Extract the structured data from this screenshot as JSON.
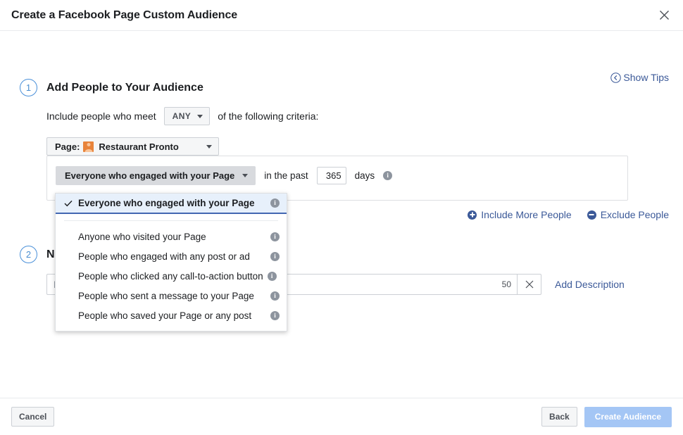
{
  "header": {
    "title": "Create a Facebook Page Custom Audience",
    "close_icon": "close-icon"
  },
  "tips": {
    "label": "Show Tips",
    "icon": "chevron-left-circle-icon"
  },
  "step1": {
    "number": "1",
    "title": "Add People to Your Audience",
    "criteria_prefix": "Include people who meet",
    "match_operator": "ANY",
    "criteria_suffix": "of the following criteria:",
    "page_label": "Page:",
    "page_name": "Restaurant Pronto",
    "condition_value": "Everyone who engaged with your Page",
    "in_the_past": "in the past",
    "days_value": "365",
    "days_label": "days"
  },
  "links": {
    "include_more": "Include More People",
    "exclude": "Exclude People"
  },
  "dropdown": {
    "items": [
      {
        "label": "Everyone who engaged with your Page",
        "selected": true
      },
      {
        "label": "Anyone who visited your Page",
        "selected": false
      },
      {
        "label": "People who engaged with any post or ad",
        "selected": false
      },
      {
        "label": "People who clicked any call-to-action button",
        "selected": false
      },
      {
        "label": "People who sent a message to your Page",
        "selected": false
      },
      {
        "label": "People who saved your Page or any post",
        "selected": false
      }
    ]
  },
  "step2": {
    "number": "2",
    "title": "Name Your Audience",
    "name_placeholder": "Name Your Audience",
    "name_value": "",
    "char_count": "50",
    "add_description": "Add Description"
  },
  "footer": {
    "cancel": "Cancel",
    "back": "Back",
    "create": "Create Audience"
  },
  "colors": {
    "accent_blue": "#3b5998",
    "selected_blue": "#4267b2",
    "selected_bg": "#e7f0fb",
    "disabled_blue": "#a4c6f5",
    "avatar_orange": "#e8833a"
  }
}
